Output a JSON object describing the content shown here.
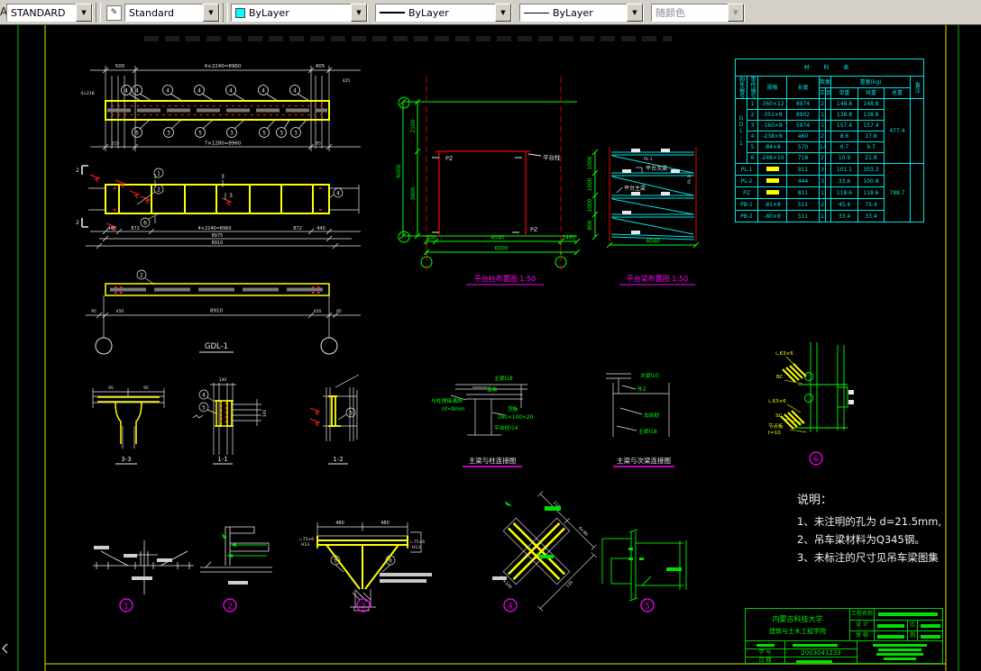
{
  "toolbar": {
    "text_style": "STANDARD",
    "dim_style": "Standard",
    "color": "ByLayer",
    "linetype": "ByLayer",
    "lineweight": "ByLayer",
    "plot_style": "随颜色",
    "color_swatch": "#00ffff"
  },
  "beam_elev": {
    "callout_top": "4",
    "callouts_bottom": [
      "5",
      "3",
      "5",
      "3",
      "5",
      "3",
      "3"
    ],
    "dim_top_left": "500",
    "dim_top_center": "4×2240=8960",
    "dim_top_right": "405",
    "dim_left_small": "4×218",
    "dim_right_small": "425",
    "dim_bottom_left": "215",
    "dim_bottom_center": "7×1280=8960",
    "dim_bottom_right": "95"
  },
  "beam_plan": {
    "sections": {
      "s1": "1",
      "s2": "2",
      "s3": "3"
    },
    "callouts": {
      "c1": "1",
      "c2": "2",
      "c6": "6",
      "c4": "4"
    },
    "dims1": [
      "440",
      "872",
      "4×2240=8960",
      "872",
      "440"
    ],
    "dim2": "8975",
    "dim3": "8910"
  },
  "flange_plan": {
    "callout": "2",
    "label": "GDL-1",
    "dim_left": "95",
    "dim_l2": "450",
    "dim_center": "8910",
    "dim_r2": "450",
    "dim_right": "95"
  },
  "plan": {
    "title": "平台柱布置图 1:50",
    "label_pz": "PZ",
    "label_col": "平台柱",
    "label_pz2": "PZ",
    "dim_v_total": "6000",
    "dim_v_top": "2100",
    "dim_v_bot": "3900",
    "dim_b1": "500",
    "dim_b2": "4040",
    "dim_b3": "1460",
    "dim_b_total": "6000"
  },
  "elev": {
    "title": "平台梁布置图 1:50",
    "label_sub": "平台次梁",
    "label_main": "平台主梁",
    "label_pl": "PL-1",
    "label_pl2": "PL-1",
    "dims_left": [
      "1000",
      "1000",
      "1000",
      "900"
    ],
    "dim_bottom": "4040"
  },
  "mat_table": {
    "title": "材 料 表",
    "h_member": "构件编号",
    "h_part": "零件编号",
    "h_spec": "规格",
    "h_len": "长度",
    "h_qty": "数量",
    "h_qty_a": "正",
    "h_qty_b": "反",
    "h_weight": "重量(kg)",
    "h_unit": "单重",
    "h_sub": "共重",
    "h_total": "总重",
    "h_note": "备注",
    "member1": "GDL-1",
    "gdl_total": "477.4",
    "rows": [
      {
        "part": "1",
        "spec": "-360×12",
        "len": "8974",
        "qty": "2",
        "unit": "148.8",
        "sub": "148.8"
      },
      {
        "part": "2",
        "spec": "-351×8",
        "len": "8902",
        "qty": "1",
        "unit": "138.8",
        "sub": "138.8"
      },
      {
        "part": "3",
        "spec": "-160×8",
        "len": "5974",
        "qty": "1",
        "unit": "157.4",
        "sub": "157.4"
      },
      {
        "part": "4",
        "spec": "-238×8",
        "len": "460",
        "qty": "2",
        "unit": "8.6",
        "sub": "17.8"
      },
      {
        "part": "5",
        "spec": "-84×8",
        "len": "570",
        "qty": "14",
        "unit": "0.7",
        "sub": "9.7"
      },
      {
        "part": "6",
        "spec": "-248×10",
        "len": "718",
        "qty": "2",
        "unit": "10.9",
        "sub": "21.8"
      }
    ],
    "rows2": [
      {
        "member": "PL-1",
        "len": "911",
        "qty": "3",
        "unit": "101.1",
        "sub": "303.3",
        "total": "788.7"
      },
      {
        "member": "PL-2",
        "len": "444",
        "qty": "3",
        "unit": "33.6",
        "sub": "100.8"
      },
      {
        "member": "PZ",
        "len": "811",
        "qty": "1",
        "unit": "118.6",
        "sub": "118.6"
      },
      {
        "member": "PB-1",
        "spec": "-81×8",
        "len": "511",
        "qty": "2",
        "unit": "45.4",
        "sub": "75.4"
      },
      {
        "member": "PB-2",
        "spec": "-80×8",
        "len": "511",
        "qty": "1",
        "unit": "33.4",
        "sub": "33.4"
      }
    ]
  },
  "sections": {
    "s33": "3-3",
    "s11": "1-1",
    "s12": "1-2",
    "c4": "4",
    "c5": "5",
    "c5b": "5",
    "s33_dim1": "95",
    "s33_dim2": "95",
    "s11_dim": "140",
    "s11_dim_r": "100"
  },
  "conn1": {
    "title": "主梁与柱连接图",
    "l1": "主梁I18",
    "l2": "垫板",
    "l3": "与柱焊接满焊",
    "l4": "hf=8mm",
    "l5": "顶板",
    "l6": "160×100×20",
    "l7": "平台柱I14"
  },
  "conn2": {
    "title": "主梁与次梁连接图",
    "l1": "次梁I10",
    "l2": "件2",
    "l3": "加劲肋",
    "l4": "主梁I18"
  },
  "detail6": {
    "num": "6",
    "l1": "∟63×6",
    "l2": "BC",
    "l3": "∟63×6",
    "l4": "SC",
    "l5": "节点板",
    "l6": "t=10"
  },
  "notes": {
    "title": "说明：",
    "line1": "1、未注明的孔为 d=21.5mm,",
    "line2": "2、吊车梁材料为Q345钢。",
    "line3": "3、未标注的尺寸见吊车梁图集"
  },
  "details": {
    "n1": "1",
    "n2": "2",
    "n3": "3",
    "n4": "4",
    "n5": "5",
    "d3_dim1": "480",
    "d3_dim2": "480",
    "d3_side_l": "∟75×6",
    "d3_side_l2": "H13",
    "d3_side_r": "∟75×6",
    "d3_side_r2": "H13",
    "d3_c5": "5",
    "d3_c6": "6",
    "d4_dim1": "210",
    "d4_dim2": "4×80",
    "d4_dim3": "135",
    "d4_dim4": "17×100"
  },
  "titleblock": {
    "school1": "内蒙古科技大学",
    "school2": "建筑与土木工程学院",
    "project_label": "工程名称",
    "r2_label": "设 计",
    "r2_small": "比",
    "r3_label": "审 核",
    "r3_small": "例",
    "id_label": "学 号",
    "student_id": "2003041233",
    "date_label": "日 期"
  }
}
